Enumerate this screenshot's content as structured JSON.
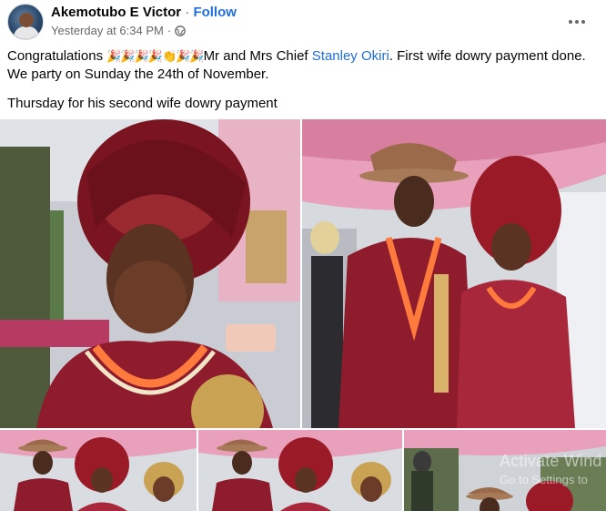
{
  "post": {
    "author": "Akemotubo E Victor",
    "separator": "·",
    "follow_label": "Follow",
    "timestamp": "Yesterday at 6:34 PM",
    "dot": "·",
    "privacy_icon": "globe-icon",
    "more_icon": "more-options-icon"
  },
  "text": {
    "congrats": "Congratulations",
    "emojis": "🎉🎉🎉🎉👏🎉🎉",
    "line1_rest_a": "Mr and Mrs Chief ",
    "mention": "Stanley Okiri",
    "line1_rest_b": ". First wife dowry payment done. We party on Sunday the 24th of November.",
    "line2": "Thursday for his second wife dowry payment"
  },
  "photos": [
    {
      "name": "photo-bride-closeup"
    },
    {
      "name": "photo-couple-standing"
    },
    {
      "name": "photo-thumb-couple-1"
    },
    {
      "name": "photo-thumb-couple-2"
    },
    {
      "name": "photo-thumb-crowd"
    }
  ],
  "watermark": {
    "title": "Activate Wind",
    "subtitle": "Go to Settings to"
  },
  "colors": {
    "link": "#216fdb",
    "secondary_text": "#65676b",
    "attire_maroon": "#8e1c2c",
    "tent_pink": "#e8a0bb"
  }
}
